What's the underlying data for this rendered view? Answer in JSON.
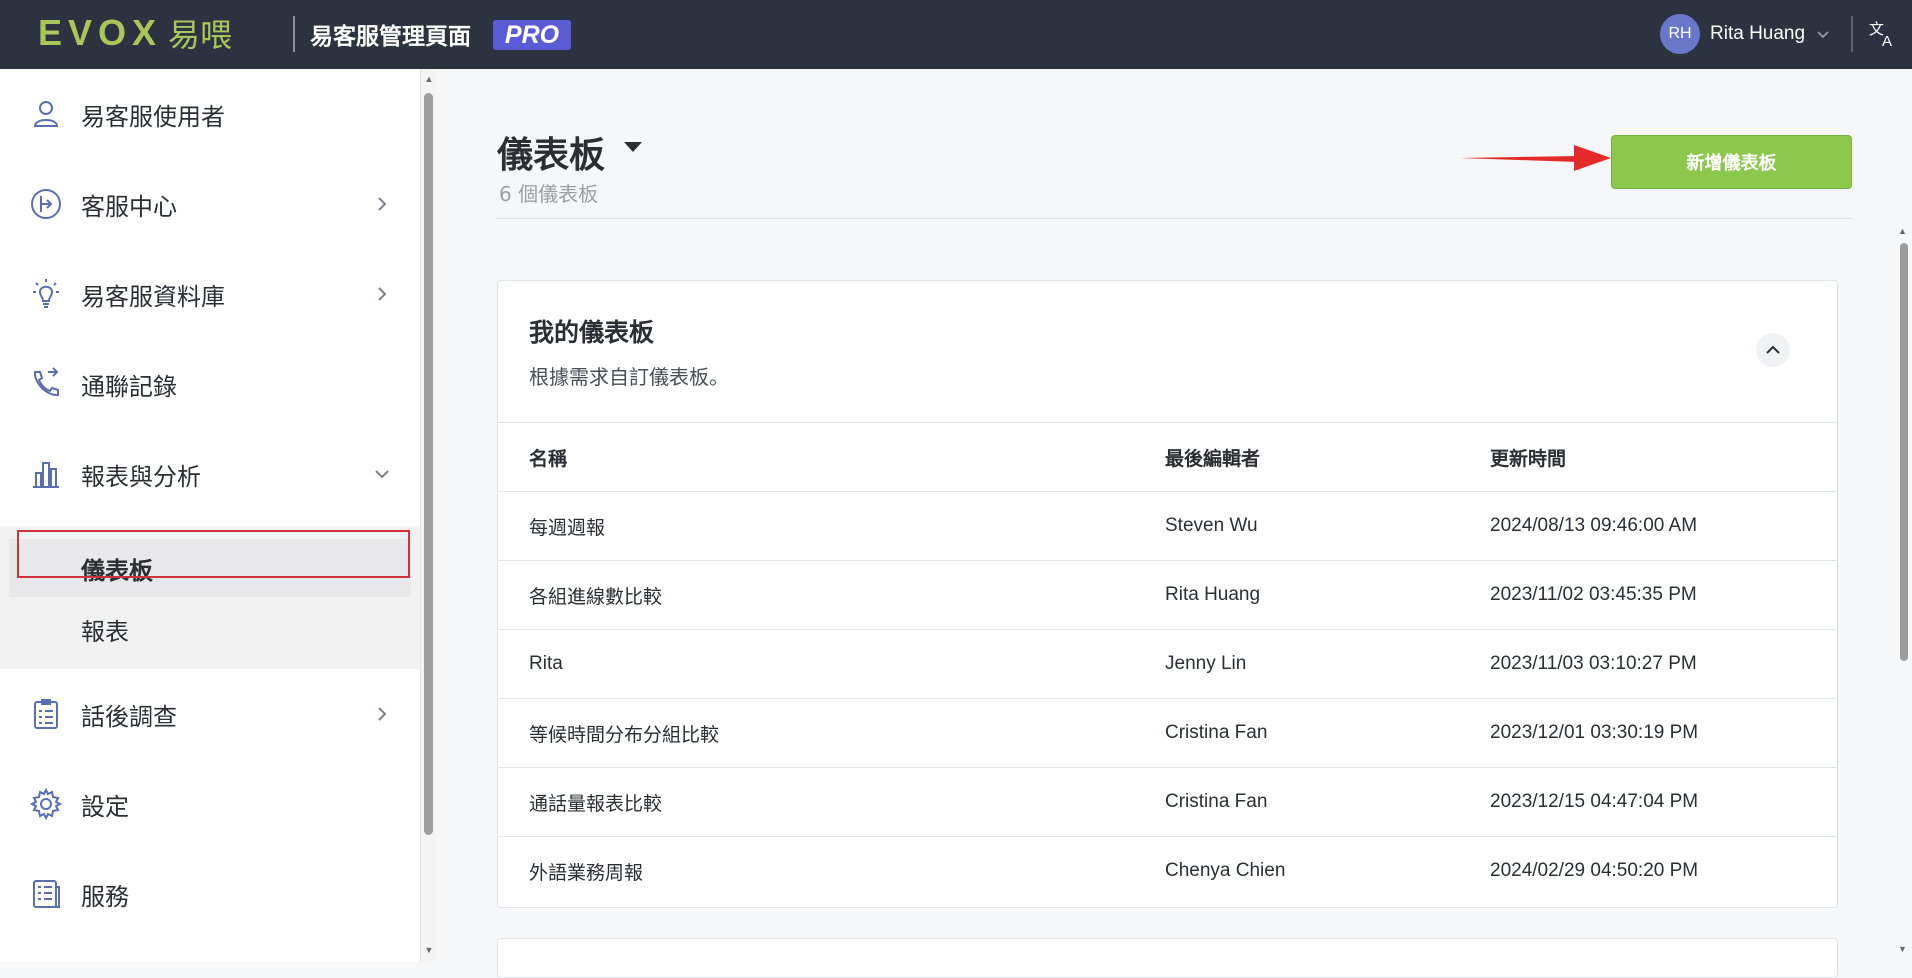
{
  "header": {
    "logo_text": "EVOX",
    "logo_cjk": "易喂",
    "app_title": "易客服管理頁面",
    "badge": "PRO",
    "user": {
      "initials": "RH",
      "name": "Rita Huang"
    }
  },
  "sidebar": {
    "items": [
      {
        "label": "易客服使用者",
        "icon": "user-icon",
        "has_chevron": false
      },
      {
        "label": "客服中心",
        "icon": "service-center-icon",
        "has_chevron": true
      },
      {
        "label": "易客服資料庫",
        "icon": "lightbulb-icon",
        "has_chevron": true
      },
      {
        "label": "通聯記錄",
        "icon": "phone-log-icon",
        "has_chevron": false
      },
      {
        "label": "報表與分析",
        "icon": "bar-chart-icon",
        "has_chevron": true,
        "expanded": true
      },
      {
        "label": "話後調查",
        "icon": "survey-icon",
        "has_chevron": true
      },
      {
        "label": "設定",
        "icon": "gear-icon",
        "has_chevron": false
      },
      {
        "label": "服務",
        "icon": "service-doc-icon",
        "has_chevron": false
      }
    ],
    "sub_items": [
      {
        "label": "儀表板",
        "active": true
      },
      {
        "label": "報表",
        "active": false
      }
    ]
  },
  "main": {
    "title": "儀表板",
    "subtitle": "6 個儀表板",
    "add_button": "新增儀表板",
    "card": {
      "title": "我的儀表板",
      "description": "根據需求自訂儀表板。",
      "columns": [
        "名稱",
        "最後編輯者",
        "更新時間"
      ],
      "rows": [
        [
          "每週週報",
          "Steven Wu",
          "2024/08/13 09:46:00 AM"
        ],
        [
          "各組進線數比較",
          "Rita Huang",
          "2023/11/02 03:45:35 PM"
        ],
        [
          "Rita",
          "Jenny Lin",
          "2023/11/03 03:10:27 PM"
        ],
        [
          "等候時間分布分組比較",
          "Cristina Fan",
          "2023/12/01 03:30:19 PM"
        ],
        [
          "通話量報表比較",
          "Cristina Fan",
          "2023/12/15 04:47:04 PM"
        ],
        [
          "外語業務周報",
          "Chenya Chien",
          "2024/02/29 04:50:20 PM"
        ]
      ]
    }
  },
  "colors": {
    "topbar": "#2c3340",
    "brand_green": "#a8c65a",
    "pro_badge": "#5b5bd6",
    "add_button": "#8cc84b",
    "annotation_red": "#e52a2a",
    "icon_blue": "#5a6fb0"
  }
}
